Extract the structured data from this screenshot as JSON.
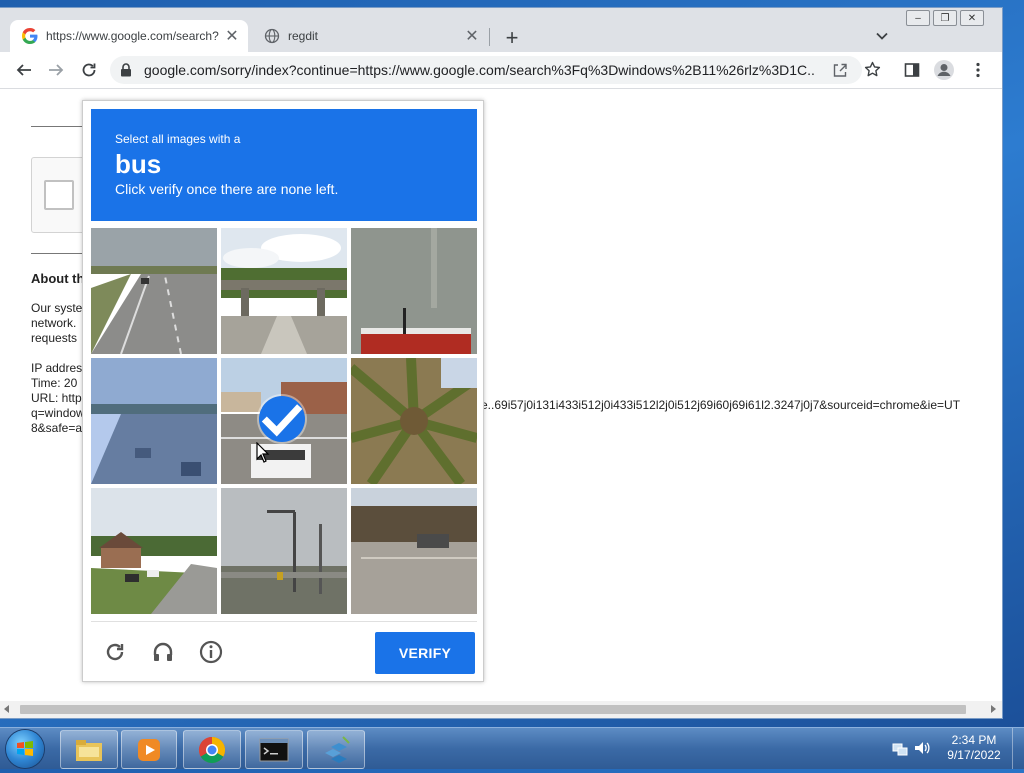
{
  "browser": {
    "tabs": [
      {
        "title": "https://www.google.com/search?",
        "favicon": "google-g-icon",
        "active": true
      },
      {
        "title": "regdit",
        "favicon": "globe-icon",
        "active": false
      }
    ],
    "address_bar": {
      "url": "google.com/sorry/index?continue=https://www.google.com/search%3Fq%3Dwindows%2B11%26rlz%3D1C..."
    },
    "window_controls": [
      "minimize",
      "restore",
      "close"
    ]
  },
  "page": {
    "about_heading": "About th",
    "body_lines": [
      "Our syste",
      "network.",
      "requests"
    ],
    "info_lines": [
      "IP addres",
      "Time: 20",
      "URL: http",
      "q=window",
      "8&safe=a"
    ],
    "url_tail": "e..69i57j0i131i433i512j0i433i512l2j0i512j69i60j69i61l2.3247j0j7&sourceid=chrome&ie=UT"
  },
  "captcha": {
    "instruction_line1": "Select all images with a",
    "target": "bus",
    "instruction_line2": "Click verify once there are none left.",
    "tiles": [
      {
        "scene": "highway",
        "selected": false
      },
      {
        "scene": "overpass",
        "selected": false
      },
      {
        "scene": "pavement",
        "selected": false
      },
      {
        "scene": "highway-shaded",
        "selected": false,
        "loading": true
      },
      {
        "scene": "intersection",
        "selected": true
      },
      {
        "scene": "palm",
        "selected": false
      },
      {
        "scene": "houses",
        "selected": false
      },
      {
        "scene": "streetlight",
        "selected": false
      },
      {
        "scene": "parking",
        "selected": false
      }
    ],
    "verify_label": "VERIFY",
    "footer_icons": [
      "reload-icon",
      "headphones-icon",
      "info-icon"
    ]
  },
  "taskbar": {
    "apps": [
      "explorer-icon",
      "media-player-icon",
      "chrome-icon",
      "cmd-icon",
      "network-icon"
    ],
    "clock_time": "2:34 PM",
    "clock_date": "9/17/2022"
  },
  "colors": {
    "accent": "#1a73e8",
    "taskbar": "#3b6aa6"
  }
}
